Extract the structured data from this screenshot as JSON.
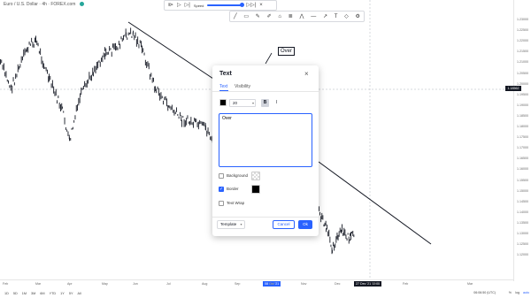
{
  "chart": {
    "symbol": "Euro / U.S. Dollar · 4h · FOREX.com",
    "current_price": "1.18562",
    "price_ticks": [
      "1.23000",
      "1.22500",
      "1.22000",
      "1.21500",
      "1.21000",
      "1.20500",
      "1.20000",
      "1.19500",
      "1.19000",
      "1.18500",
      "1.18000",
      "1.17500",
      "1.17000",
      "1.16500",
      "1.16000",
      "1.15500",
      "1.15000",
      "1.14500",
      "1.14000",
      "1.13500",
      "1.13000",
      "1.12500",
      "1.12000"
    ],
    "time_ticks": [
      "Feb",
      "Mar",
      "Apr",
      "May",
      "Jun",
      "Jul",
      "Aug",
      "Sep",
      "Oct",
      "Nov",
      "Dec",
      "'22",
      "Feb",
      "Mar"
    ],
    "replay_start_flag": "08 Oct '21",
    "replay_end_flag": "27 Dec '21  12:00",
    "canvas_text_label": "Over"
  },
  "replay_toolbar": {
    "speed_label": "Speed"
  },
  "drawing_toolbar": {
    "icons": [
      "trendline-icon",
      "rectangle-icon",
      "brush-icon",
      "pencil-icon",
      "text-icon",
      "fib-icon",
      "path-icon",
      "horizontal-line-icon",
      "arrow-icon",
      "pin-icon",
      "shape-icon",
      "settings-icon"
    ]
  },
  "bottom_bar": {
    "ranges": [
      "1D",
      "5D",
      "1M",
      "3M",
      "6M",
      "YTD",
      "1Y",
      "5Y",
      "All"
    ],
    "clock": "06:06:50 (UTC)",
    "pct": "%",
    "log": "log",
    "auto": "auto"
  },
  "dialog": {
    "title": "Text",
    "tabs": [
      "Text",
      "Visibility"
    ],
    "font_size": "20",
    "bold": "B",
    "italic": "I",
    "text_value": "Over",
    "background_label": "Background",
    "background_checked": false,
    "border_label": "Border",
    "border_checked": true,
    "text_wrap_label": "Text Wrap",
    "text_wrap_checked": false,
    "template_label": "Template",
    "cancel_label": "Cancel",
    "ok_label": "Ok",
    "accent_color": "#2962ff",
    "text_color": "#000000",
    "border_color": "#000000"
  }
}
